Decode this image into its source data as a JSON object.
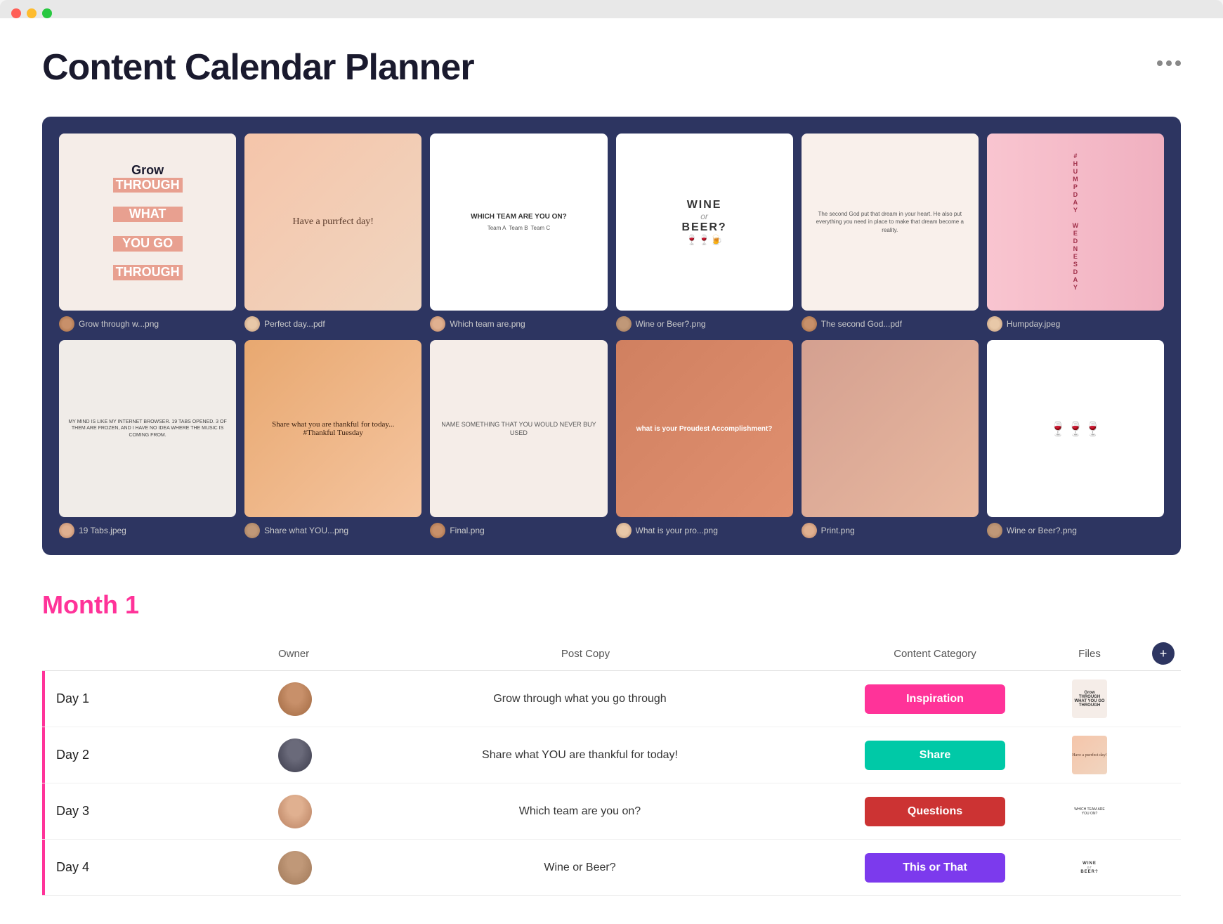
{
  "app": {
    "title": "Content Calendar Planner",
    "more_options_label": "···"
  },
  "gallery": {
    "row1": [
      {
        "filename": "Grow through w...png",
        "thumb_type": "grow"
      },
      {
        "filename": "Perfect day...pdf",
        "thumb_type": "purrfect"
      },
      {
        "filename": "Which team are.png",
        "thumb_type": "team"
      },
      {
        "filename": "Wine or Beer?.png",
        "thumb_type": "wine"
      },
      {
        "filename": "The second God...pdf",
        "thumb_type": "quote"
      },
      {
        "filename": "Humpday.jpeg",
        "thumb_type": "humpday"
      }
    ],
    "row2": [
      {
        "filename": "19 Tabs.jpeg",
        "thumb_type": "tabs"
      },
      {
        "filename": "Share what YOU...png",
        "thumb_type": "thankful"
      },
      {
        "filename": "Final.png",
        "thumb_type": "name"
      },
      {
        "filename": "What is your pro...png",
        "thumb_type": "proudest"
      },
      {
        "filename": "Print.png",
        "thumb_type": "floral"
      },
      {
        "filename": "Wine or Beer?.png",
        "thumb_type": "wine2"
      }
    ]
  },
  "table": {
    "section_title": "Month 1",
    "headers": {
      "owner": "Owner",
      "post_copy": "Post Copy",
      "content_category": "Content Category",
      "files": "Files"
    },
    "rows": [
      {
        "day": "Day 1",
        "post_copy": "Grow through what you go through",
        "category": "Inspiration",
        "category_class": "badge-inspiration",
        "file_type": "grow"
      },
      {
        "day": "Day 2",
        "post_copy": "Share what YOU are thankful for today!",
        "category": "Share",
        "category_class": "badge-share",
        "file_type": "purrfect"
      },
      {
        "day": "Day 3",
        "post_copy": "Which team are you on?",
        "category": "Questions",
        "category_class": "badge-questions",
        "file_type": "team"
      },
      {
        "day": "Day 4",
        "post_copy": "Wine or Beer?",
        "category": "This or That",
        "category_class": "badge-this-or-that",
        "file_type": "wine"
      }
    ]
  }
}
